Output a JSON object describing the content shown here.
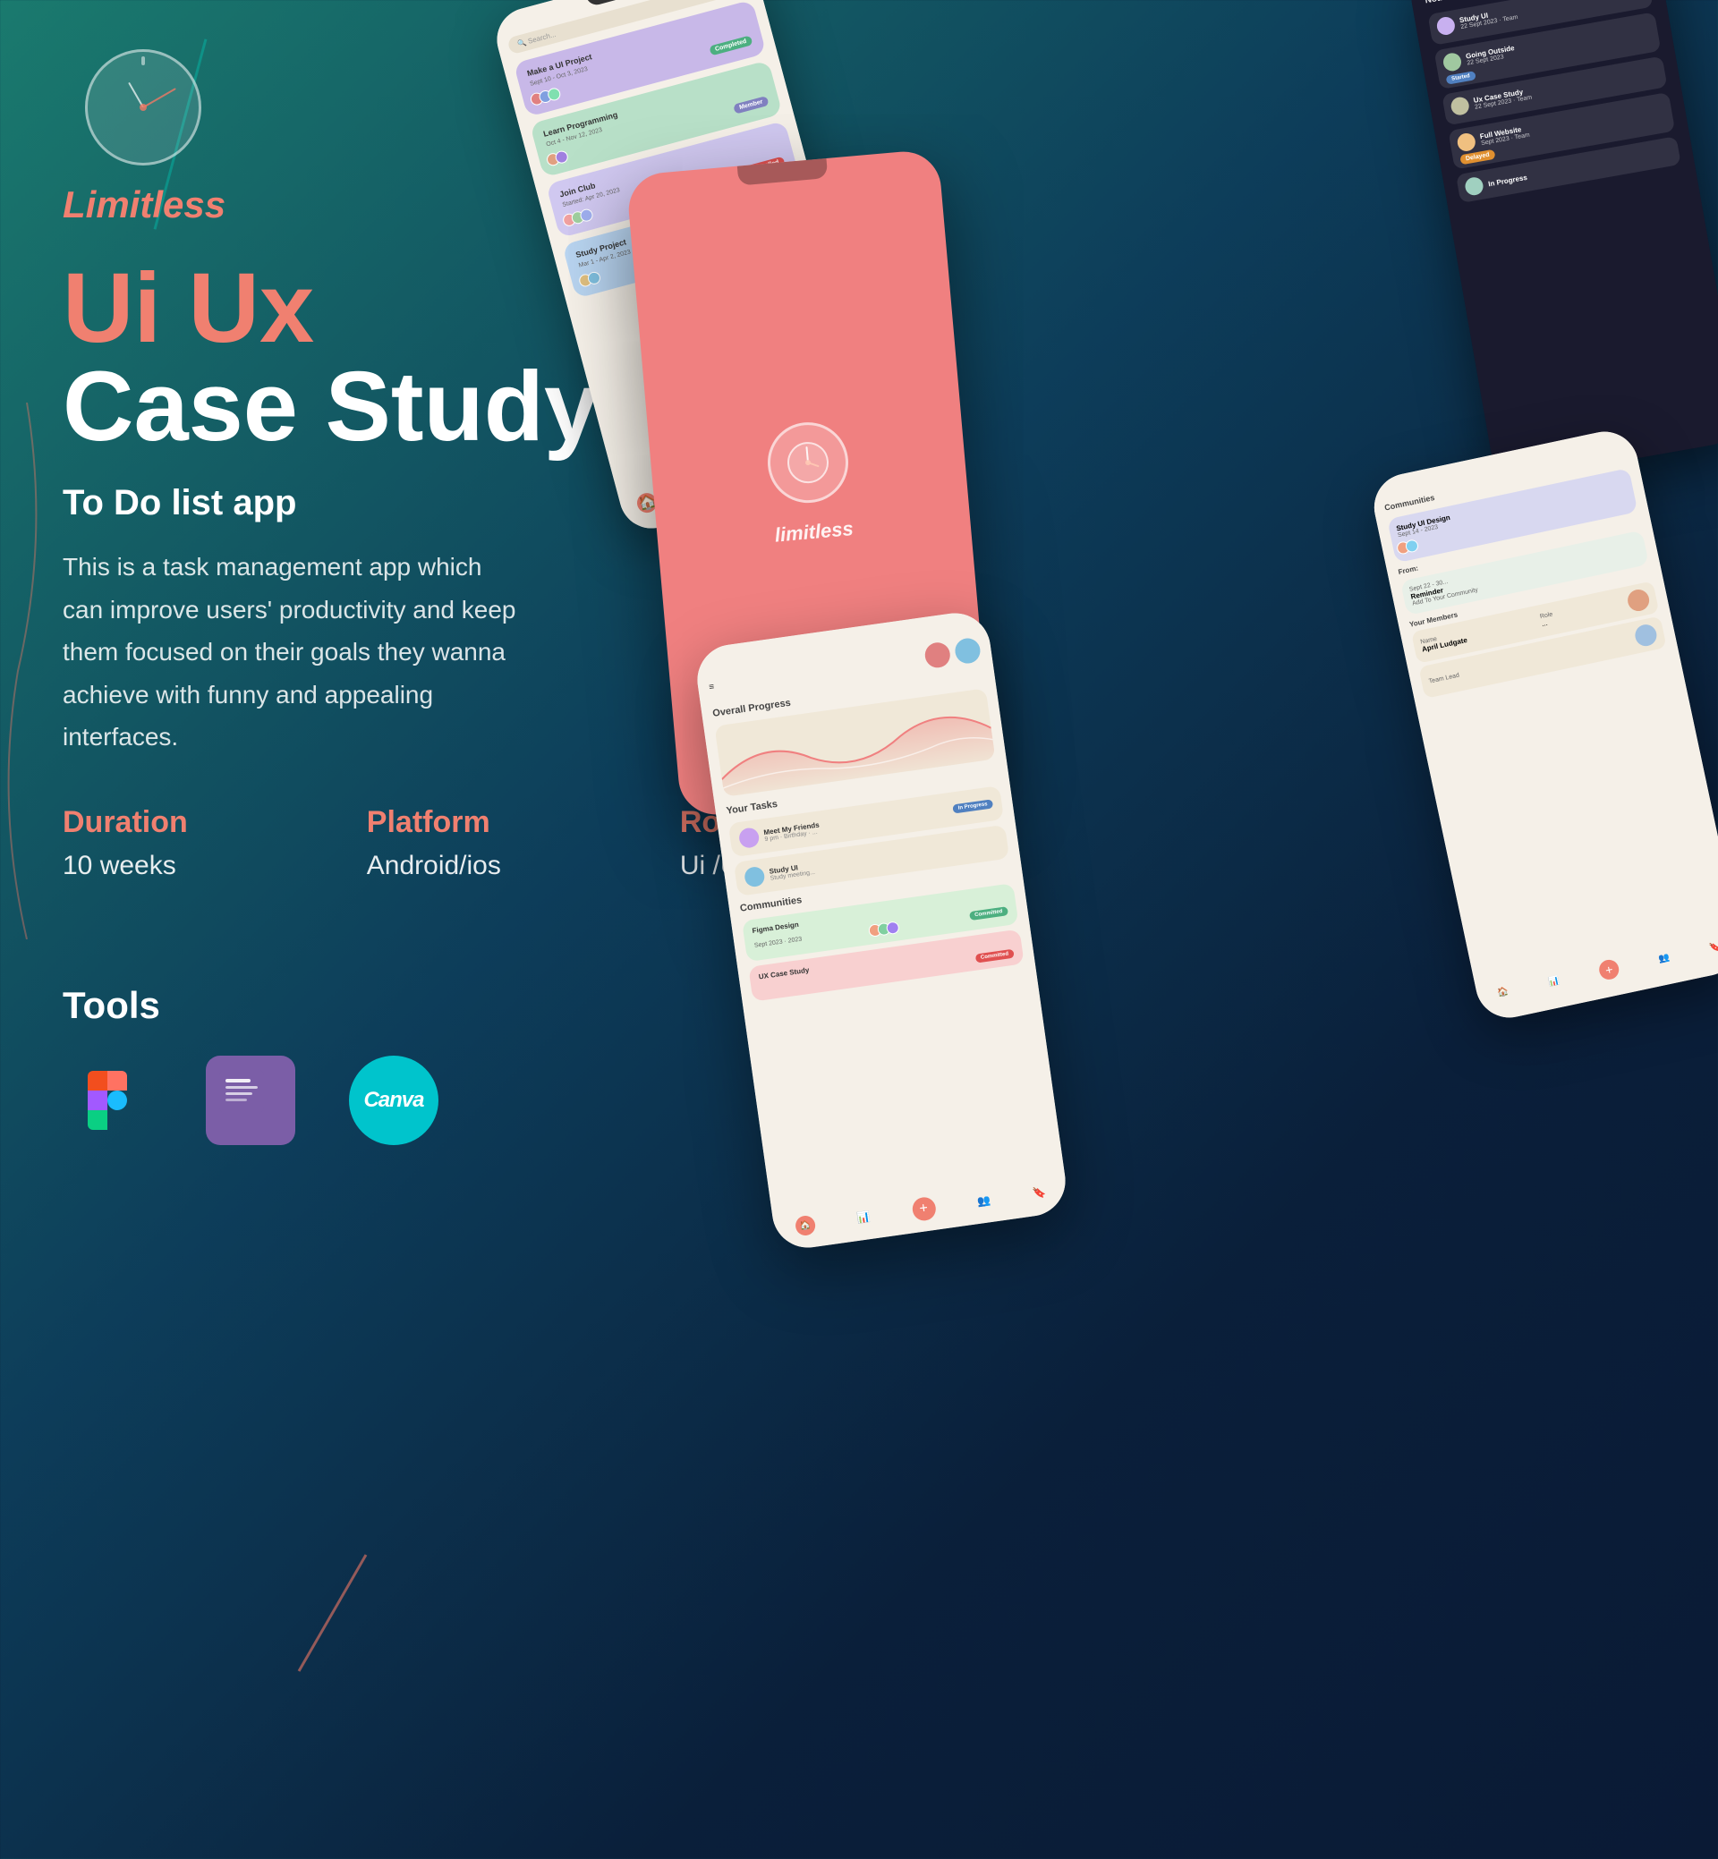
{
  "brand": {
    "name": "Limitless",
    "tagline": "limitless"
  },
  "header": {
    "title_line1": "Ui Ux",
    "title_line2": "Case Study",
    "subtitle": "To Do list app",
    "description": "This is a task management app which can improve users' productivity and keep them focused on their goals they wanna achieve with funny and appealing interfaces."
  },
  "info": {
    "duration_label": "Duration",
    "duration_value": "10 weeks",
    "platform_label": "Platform",
    "platform_value": "Android/ios",
    "role_label": "Role",
    "role_value": "Ui /Ux designer"
  },
  "tools": {
    "title": "Tools",
    "items": [
      {
        "name": "Figma",
        "icon": "figma"
      },
      {
        "name": "Notion",
        "icon": "notion"
      },
      {
        "name": "Canva",
        "icon": "canva"
      }
    ]
  },
  "phones": {
    "splash_brand": "limitless"
  },
  "colors": {
    "accent": "#f08070",
    "bg_start": "#1a7a6e",
    "bg_end": "#0a1a35",
    "white": "#ffffff"
  }
}
